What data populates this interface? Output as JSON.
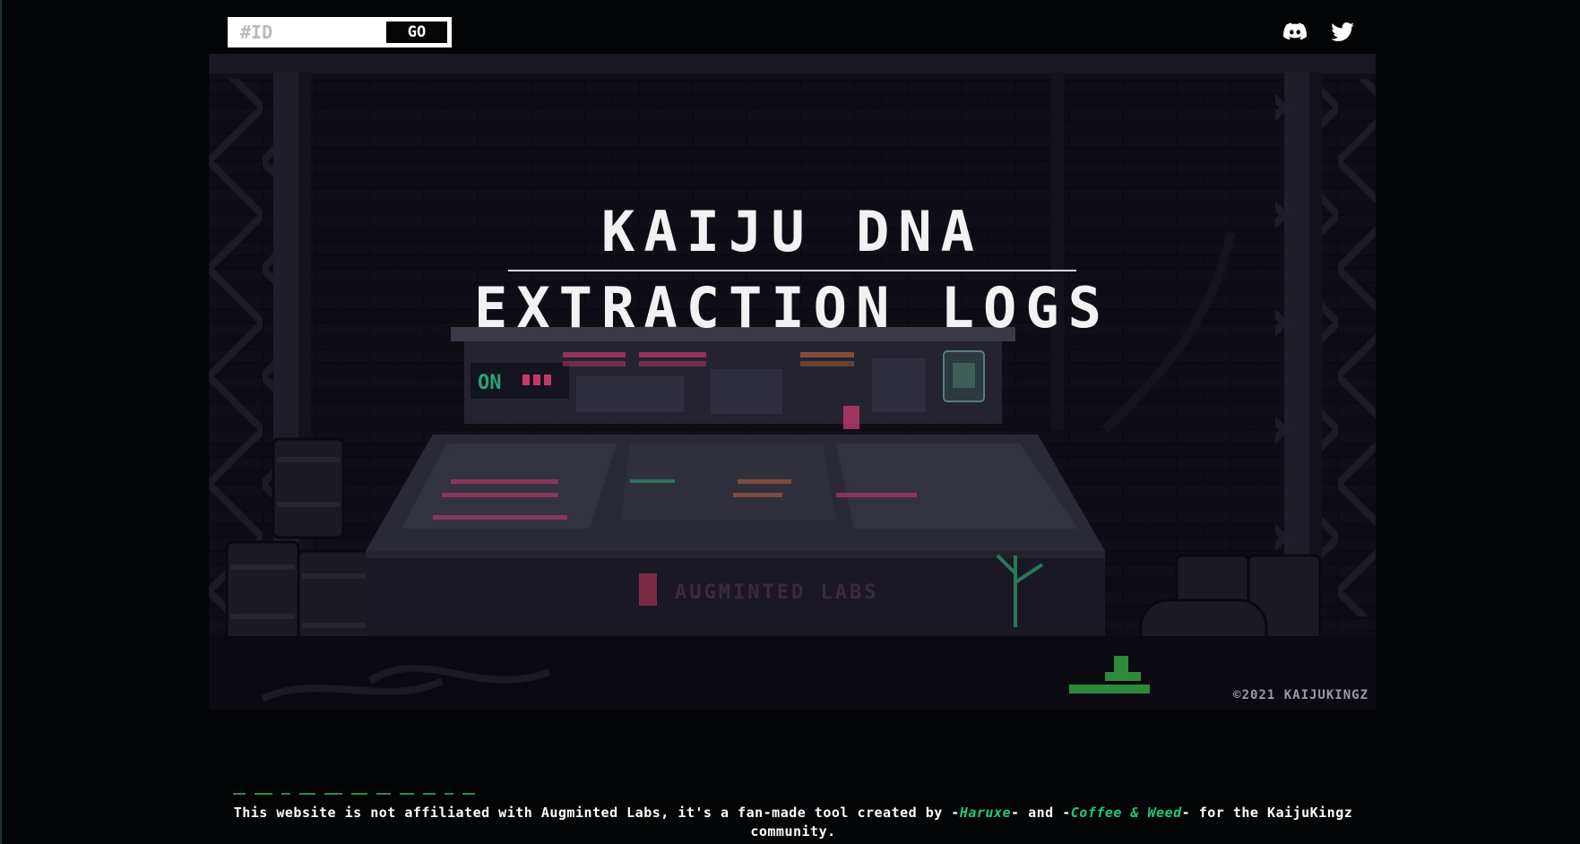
{
  "search": {
    "placeholder": "#ID",
    "go_label": "GO"
  },
  "social": {
    "discord_icon": "discord-icon",
    "twitter_icon": "twitter-icon"
  },
  "hero": {
    "title_line1": "KAIJU DNA",
    "title_line2": "EXTRACTION LOGS",
    "machine_on_label": "ON",
    "machine_brand": "AUGMINTED LABS",
    "copyright": "©2021 KAIJUKINGZ"
  },
  "footer": {
    "text_before": "This website is not affiliated with Augminted Labs, it's a fan-made tool created by -",
    "author1": "Haruxe",
    "text_mid": "- and -",
    "author2": "Coffee & Weed",
    "text_after": "- for the KaijuKingz community."
  },
  "colors": {
    "background": "#030406",
    "accent_green": "#23c878",
    "accent_pink": "#c23a6a",
    "title_white": "#f2f2f2"
  }
}
